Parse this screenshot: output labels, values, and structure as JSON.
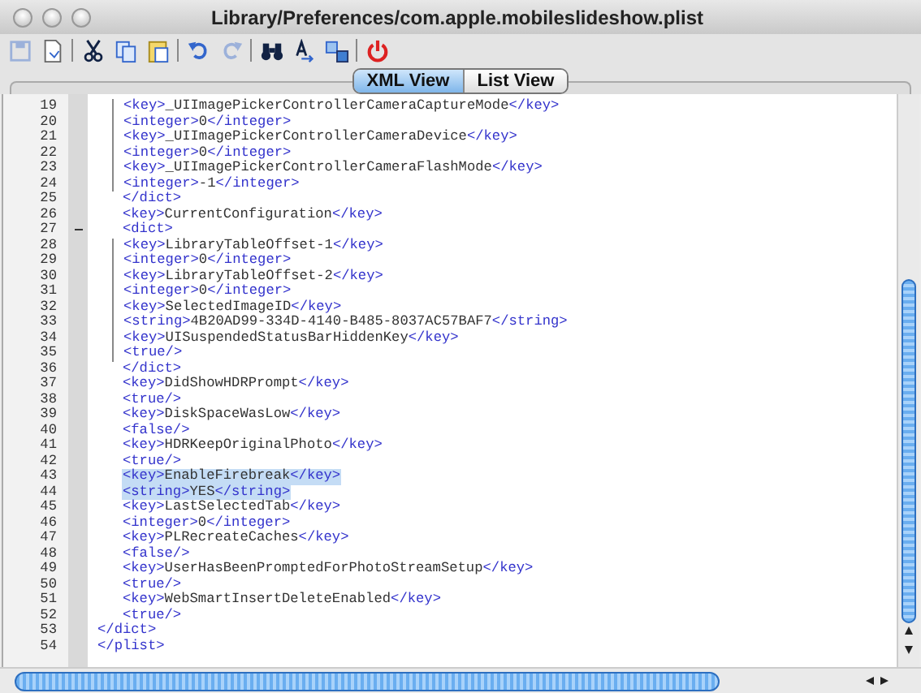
{
  "window": {
    "title": "Library/Preferences/com.apple.mobileslideshow.plist"
  },
  "toolbar": [
    {
      "kind": "save",
      "disabled": true
    },
    {
      "kind": "new",
      "disabled": false
    },
    {
      "kind": "sep"
    },
    {
      "kind": "cut",
      "disabled": false
    },
    {
      "kind": "copy",
      "disabled": false
    },
    {
      "kind": "paste",
      "disabled": false
    },
    {
      "kind": "sep"
    },
    {
      "kind": "undo",
      "disabled": false
    },
    {
      "kind": "redo",
      "disabled": true
    },
    {
      "kind": "sep"
    },
    {
      "kind": "find",
      "disabled": false
    },
    {
      "kind": "findnext",
      "disabled": false
    },
    {
      "kind": "replace",
      "disabled": false
    },
    {
      "kind": "sep"
    },
    {
      "kind": "power",
      "disabled": false
    }
  ],
  "tabs": [
    {
      "label": "XML View",
      "selected": true
    },
    {
      "label": "List View",
      "selected": false
    }
  ],
  "editor": {
    "lines": [
      {
        "number": "19",
        "text": "      <key>_UIImagePickerControllerCameraCaptureMode</key>",
        "selected": false,
        "foldable": false
      },
      {
        "number": "20",
        "text": "      <integer>0</integer>",
        "selected": false,
        "foldable": false
      },
      {
        "number": "21",
        "text": "      <key>_UIImagePickerControllerCameraDevice</key>",
        "selected": false,
        "foldable": false
      },
      {
        "number": "22",
        "text": "      <integer>0</integer>",
        "selected": false,
        "foldable": false
      },
      {
        "number": "23",
        "text": "      <key>_UIImagePickerControllerCameraFlashMode</key>",
        "selected": false,
        "foldable": false
      },
      {
        "number": "24",
        "text": "      <integer>-1</integer>",
        "selected": false,
        "foldable": false
      },
      {
        "number": "25",
        "text": "   </dict>",
        "selected": false,
        "foldable": false
      },
      {
        "number": "26",
        "text": "   <key>CurrentConfiguration</key>",
        "selected": false,
        "foldable": false
      },
      {
        "number": "27",
        "text": "   <dict>",
        "selected": false,
        "foldable": true
      },
      {
        "number": "28",
        "text": "      <key>LibraryTableOffset-1</key>",
        "selected": false,
        "foldable": false
      },
      {
        "number": "29",
        "text": "      <integer>0</integer>",
        "selected": false,
        "foldable": false
      },
      {
        "number": "30",
        "text": "      <key>LibraryTableOffset-2</key>",
        "selected": false,
        "foldable": false
      },
      {
        "number": "31",
        "text": "      <integer>0</integer>",
        "selected": false,
        "foldable": false
      },
      {
        "number": "32",
        "text": "      <key>SelectedImageID</key>",
        "selected": false,
        "foldable": false
      },
      {
        "number": "33",
        "text": "      <string>4B20AD99-334D-4140-B485-8037AC57BAF7</string>",
        "selected": false,
        "foldable": false
      },
      {
        "number": "34",
        "text": "      <key>UISuspendedStatusBarHiddenKey</key>",
        "selected": false,
        "foldable": false
      },
      {
        "number": "35",
        "text": "      <true/>",
        "selected": false,
        "foldable": false
      },
      {
        "number": "36",
        "text": "   </dict>",
        "selected": false,
        "foldable": false
      },
      {
        "number": "37",
        "text": "   <key>DidShowHDRPrompt</key>",
        "selected": false,
        "foldable": false
      },
      {
        "number": "38",
        "text": "   <true/>",
        "selected": false,
        "foldable": false
      },
      {
        "number": "39",
        "text": "   <key>DiskSpaceWasLow</key>",
        "selected": false,
        "foldable": false
      },
      {
        "number": "40",
        "text": "   <false/>",
        "selected": false,
        "foldable": false
      },
      {
        "number": "41",
        "text": "   <key>HDRKeepOriginalPhoto</key>",
        "selected": false,
        "foldable": false
      },
      {
        "number": "42",
        "text": "   <true/>",
        "selected": false,
        "foldable": false
      },
      {
        "number": "43",
        "text": "   <key>EnableFirebreak</key>",
        "selected": true,
        "foldable": false
      },
      {
        "number": "44",
        "text": "   <string>YES</string>",
        "selected": true,
        "foldable": false
      },
      {
        "number": "45",
        "text": "   <key>LastSelectedTab</key>",
        "selected": false,
        "foldable": false
      },
      {
        "number": "46",
        "text": "   <integer>0</integer>",
        "selected": false,
        "foldable": false
      },
      {
        "number": "47",
        "text": "   <key>PLRecreateCaches</key>",
        "selected": false,
        "foldable": false
      },
      {
        "number": "48",
        "text": "   <false/>",
        "selected": false,
        "foldable": false
      },
      {
        "number": "49",
        "text": "   <key>UserHasBeenPromptedForPhotoStreamSetup</key>",
        "selected": false,
        "foldable": false
      },
      {
        "number": "50",
        "text": "   <true/>",
        "selected": false,
        "foldable": false
      },
      {
        "number": "51",
        "text": "   <key>WebSmartInsertDeleteEnabled</key>",
        "selected": false,
        "foldable": false
      },
      {
        "number": "52",
        "text": "   <true/>",
        "selected": false,
        "foldable": false
      },
      {
        "number": "53",
        "text": "</dict>",
        "selected": false,
        "foldable": false
      },
      {
        "number": "54",
        "text": "</plist>",
        "selected": false,
        "foldable": false
      }
    ]
  }
}
